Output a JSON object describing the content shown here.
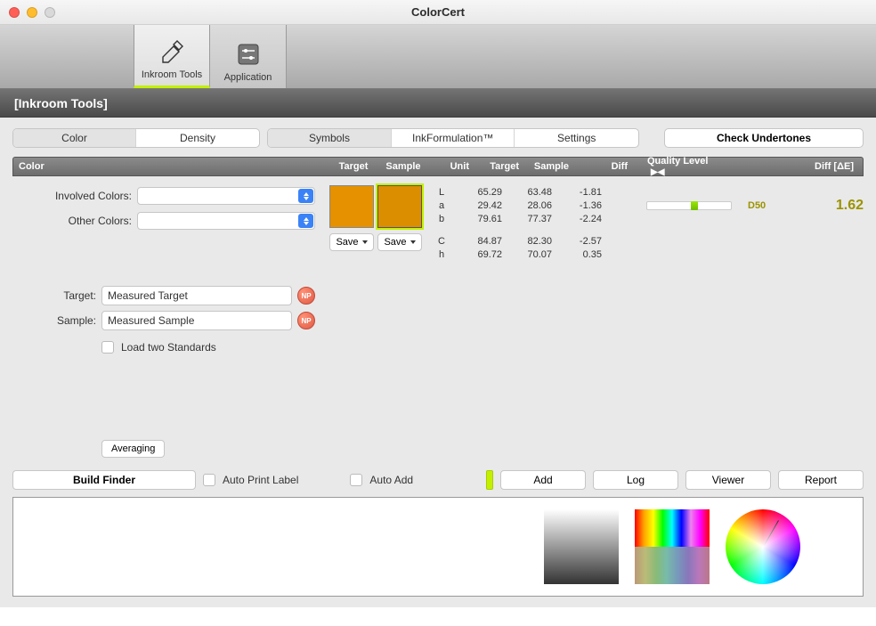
{
  "window": {
    "title": "ColorCert"
  },
  "toolbar": {
    "inkroom": "Inkroom Tools",
    "application": "Application"
  },
  "subheader": "[Inkroom Tools]",
  "tabs": {
    "group1": [
      "Color",
      "Density"
    ],
    "group2": [
      "Symbols",
      "InkFormulation™",
      "Settings"
    ],
    "check": "Check Undertones"
  },
  "columns": {
    "color": "Color",
    "target": "Target",
    "sample": "Sample",
    "unit": "Unit",
    "target2": "Target",
    "sample2": "Sample",
    "diff": "Diff",
    "quality": "Quality Level",
    "diffde": "Diff [ΔE]"
  },
  "left": {
    "involved": "Involved Colors:",
    "other": "Other Colors:",
    "target_label": "Target:",
    "sample_label": "Sample:",
    "target_value": "Measured Target",
    "sample_value": "Measured Sample",
    "load_two": "Load two Standards",
    "averaging": "Averaging",
    "np": "NP"
  },
  "swatch": {
    "target_color": "#e59100",
    "sample_color": "#da8e00",
    "save": "Save"
  },
  "lab": {
    "rows": [
      {
        "u": "L",
        "t": "65.29",
        "s": "63.48",
        "d": "-1.81"
      },
      {
        "u": "a",
        "t": "29.42",
        "s": "28.06",
        "d": "-1.36"
      },
      {
        "u": "b",
        "t": "79.61",
        "s": "77.37",
        "d": "-2.24"
      }
    ],
    "rows2": [
      {
        "u": "C",
        "t": "84.87",
        "s": "82.30",
        "d": "-2.57"
      },
      {
        "u": "h",
        "t": "69.72",
        "s": "70.07",
        "d": "0.35"
      }
    ]
  },
  "quality": {
    "illuminant": "D50",
    "delta_e": "1.62"
  },
  "actions": {
    "build_finder": "Build Finder",
    "auto_print": "Auto Print Label",
    "auto_add": "Auto Add",
    "add": "Add",
    "log": "Log",
    "viewer": "Viewer",
    "report": "Report"
  }
}
